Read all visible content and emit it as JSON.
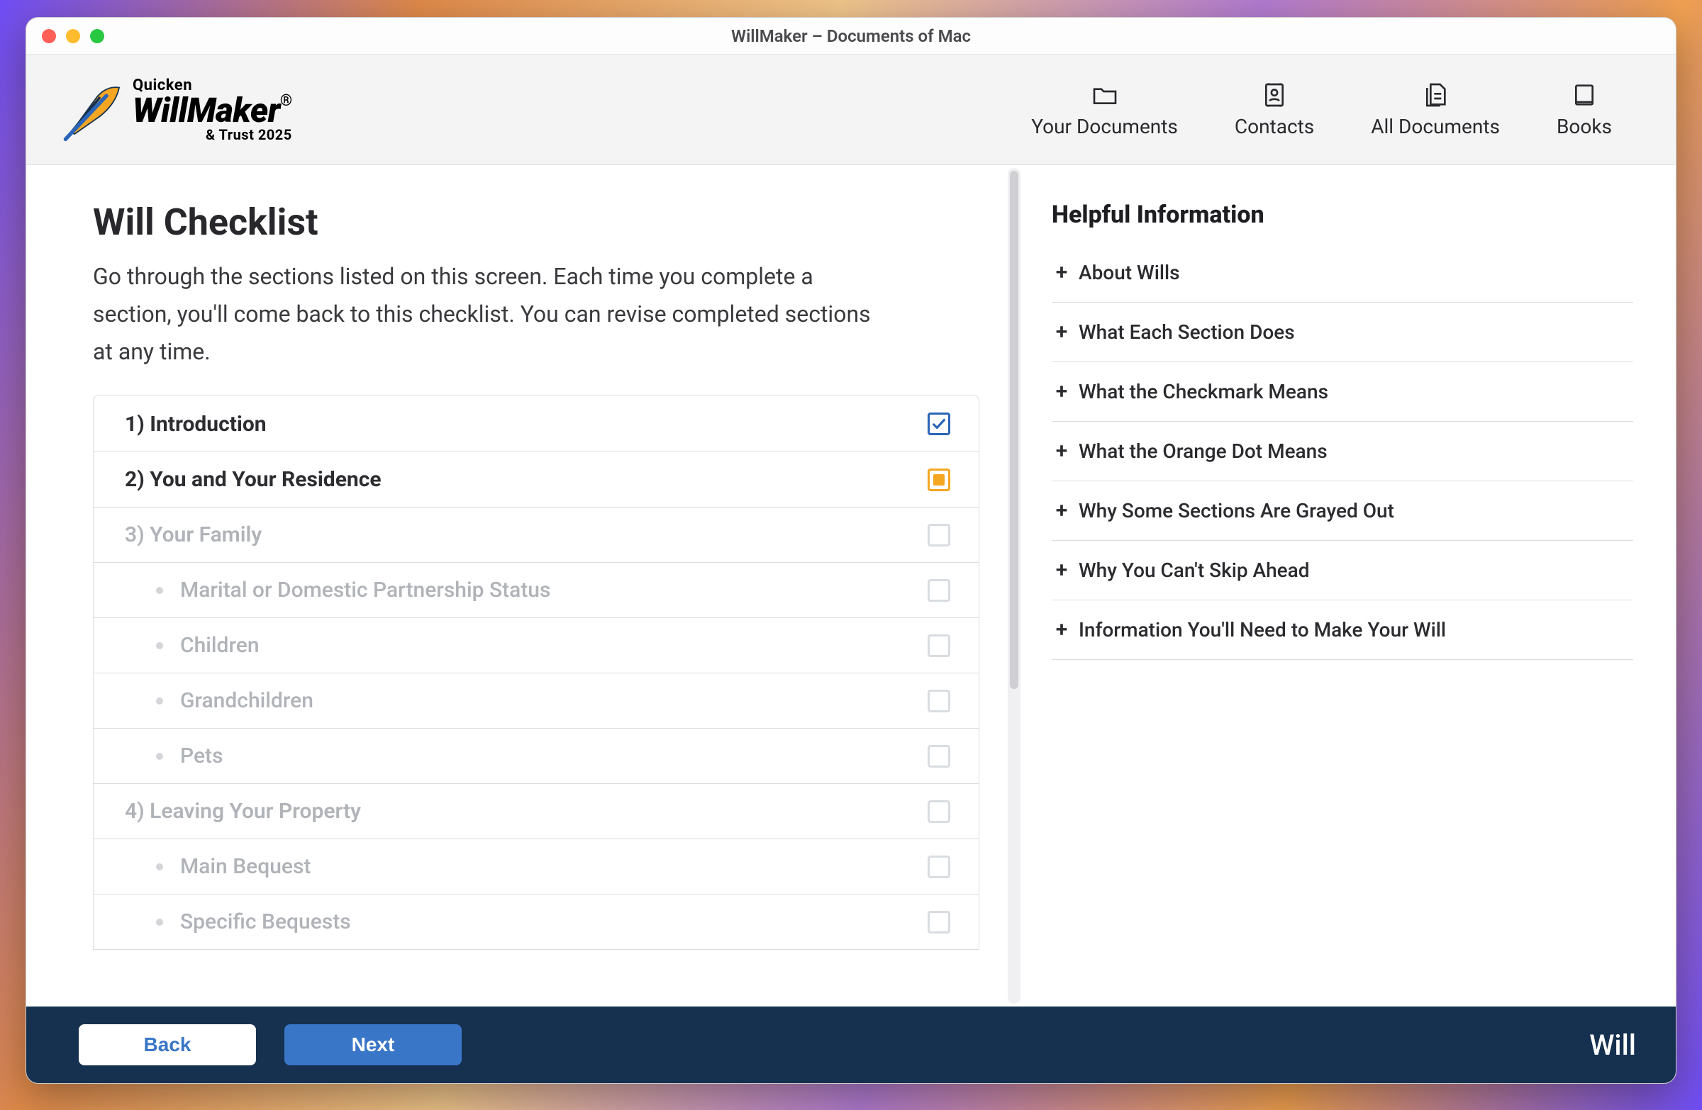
{
  "window_title": "WillMaker – Documents of Mac",
  "brand": {
    "quicken": "Quicken",
    "willmaker": "WillMaker",
    "reg": "®",
    "trust": "& Trust 2025"
  },
  "nav": {
    "your_documents": "Your Documents",
    "contacts": "Contacts",
    "all_documents": "All Documents",
    "books": "Books"
  },
  "main": {
    "title": "Will Checklist",
    "description": "Go through the sections listed on this screen. Each time you complete a section, you'll come back to this checklist. You can revise completed sections at any time."
  },
  "checklist": [
    {
      "label": "1) Introduction",
      "state": "checked",
      "sub": false,
      "disabled": false
    },
    {
      "label": "2) You and Your Residence",
      "state": "active",
      "sub": false,
      "disabled": false
    },
    {
      "label": "3) Your Family",
      "state": "empty",
      "sub": false,
      "disabled": true
    },
    {
      "label": "Marital or Domestic Partnership Status",
      "state": "empty",
      "sub": true,
      "disabled": true
    },
    {
      "label": "Children",
      "state": "empty",
      "sub": true,
      "disabled": true
    },
    {
      "label": "Grandchildren",
      "state": "empty",
      "sub": true,
      "disabled": true
    },
    {
      "label": "Pets",
      "state": "empty",
      "sub": true,
      "disabled": true
    },
    {
      "label": "4) Leaving Your Property",
      "state": "empty",
      "sub": false,
      "disabled": true
    },
    {
      "label": "Main Bequest",
      "state": "empty",
      "sub": true,
      "disabled": true
    },
    {
      "label": "Specific Bequests",
      "state": "empty",
      "sub": true,
      "disabled": true
    }
  ],
  "side": {
    "title": "Helpful Information",
    "items": [
      "About Wills",
      "What Each Section Does",
      "What the Checkmark Means",
      "What the Orange Dot Means",
      "Why Some Sections Are Grayed Out",
      "Why You Can't Skip Ahead",
      "Information You'll Need to Make Your Will"
    ]
  },
  "footer": {
    "back": "Back",
    "next": "Next",
    "doc_type": "Will"
  }
}
